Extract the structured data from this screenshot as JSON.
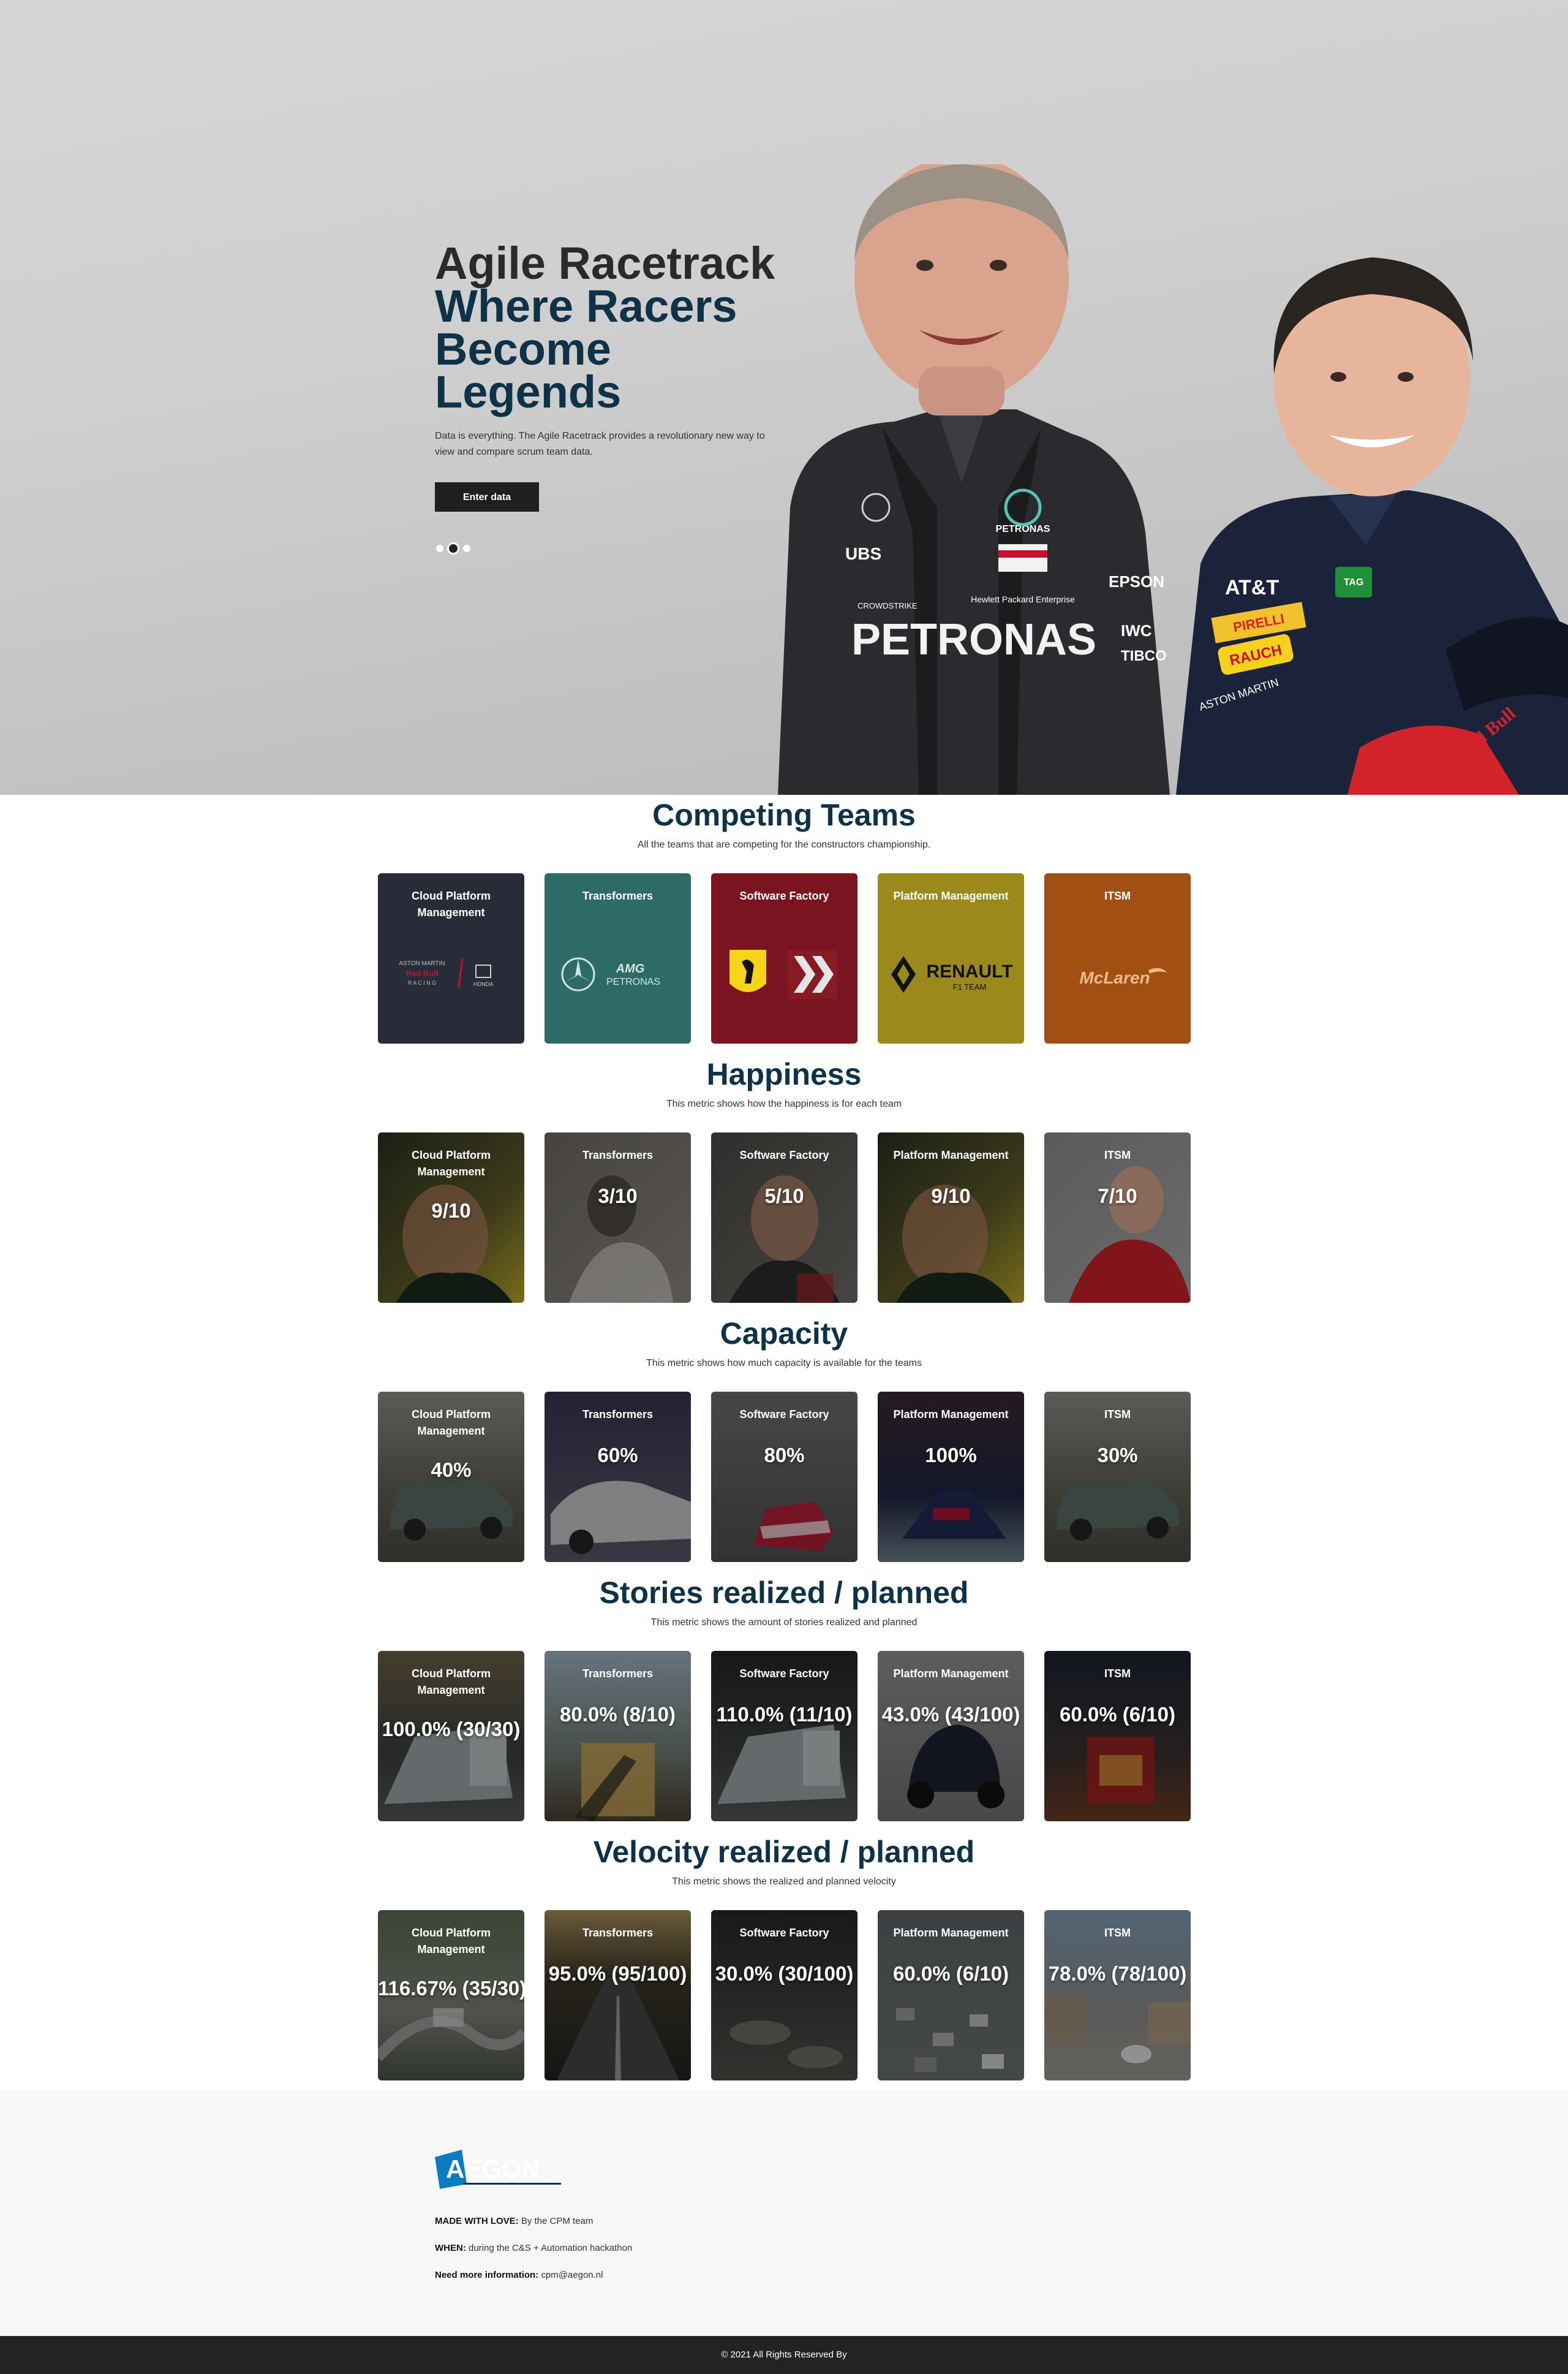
{
  "hero": {
    "title_line1": "Agile Racetrack",
    "title_line2": "Where Racers",
    "title_line3": "Become",
    "title_line4": "Legends",
    "description": "Data is everything. The Agile Racetrack provides a revolutionary new way to view and compare scrum team data.",
    "button_label": "Enter data",
    "racer1_suit": "PETRONAS",
    "racer1_brands": [
      "PETRONAS",
      "UBS",
      "Hewlett Packard Enterprise",
      "EPSON",
      "IWC",
      "TIBCO",
      "CROWDSTRIKE"
    ],
    "racer2_brands": [
      "AT&T",
      "TAG",
      "PIRELLI",
      "RAUCH",
      "ASTON MARTIN",
      "Red Bull"
    ],
    "carousel": {
      "count": 3,
      "active": 1
    }
  },
  "sections": [
    {
      "title": "Competing Teams",
      "subtitle": "All the teams that are competing for the constructors championship.",
      "cards": [
        {
          "name": "Cloud Platform Management",
          "value": "",
          "logo": "ASTON MARTIN | Red Bull RACING | HONDA",
          "bg": "#272c38"
        },
        {
          "name": "Transformers",
          "value": "",
          "logo": "AMG PETRONAS",
          "bg": "#2f6b66"
        },
        {
          "name": "Software Factory",
          "value": "",
          "logo": "Ferrari",
          "bg": "#7a1420"
        },
        {
          "name": "Platform Management",
          "value": "",
          "logo": "RENAULT F1 TEAM",
          "bg": "#9b8a1b"
        },
        {
          "name": "ITSM",
          "value": "",
          "logo": "McLaren",
          "bg": "#a24f14"
        }
      ]
    },
    {
      "title": "Happiness",
      "subtitle": "This metric shows how the happiness is for each team",
      "cards": [
        {
          "name": "Cloud Platform Management",
          "value": "9/10",
          "bg": "#4a4d2b"
        },
        {
          "name": "Transformers",
          "value": "3/10",
          "bg": "#6a6662"
        },
        {
          "name": "Software Factory",
          "value": "5/10",
          "bg": "#5c5a57"
        },
        {
          "name": "Platform Management",
          "value": "9/10",
          "bg": "#4a4d2b"
        },
        {
          "name": "ITSM",
          "value": "7/10",
          "bg": "#8a3a3a"
        }
      ]
    },
    {
      "title": "Capacity",
      "subtitle": "This metric shows how much capacity is available for the teams",
      "cards": [
        {
          "name": "Cloud Platform Management",
          "value": "40%",
          "bg": "#5b5a50"
        },
        {
          "name": "Transformers",
          "value": "60%",
          "bg": "#4a4656"
        },
        {
          "name": "Software Factory",
          "value": "80%",
          "bg": "#5d5d5d"
        },
        {
          "name": "Platform Management",
          "value": "100%",
          "bg": "#2b2f4a"
        },
        {
          "name": "ITSM",
          "value": "30%",
          "bg": "#5b5a50"
        }
      ]
    },
    {
      "title": "Stories realized / planned",
      "subtitle": "This metric shows the amount of stories realized and planned",
      "cards": [
        {
          "name": "Cloud Platform Management",
          "value": "100.0% (30/30)",
          "bg": "#3d4240"
        },
        {
          "name": "Transformers",
          "value": "80.0% (8/10)",
          "bg": "#5a5040"
        },
        {
          "name": "Software Factory",
          "value": "110.0% (11/10)",
          "bg": "#2f3330"
        },
        {
          "name": "Platform Management",
          "value": "43.0% (43/100)",
          "bg": "#5a5a5a"
        },
        {
          "name": "ITSM",
          "value": "60.0% (6/10)",
          "bg": "#2a2a33"
        }
      ]
    },
    {
      "title": "Velocity realized / planned",
      "subtitle": "This metric shows the realized and planned velocity",
      "cards": [
        {
          "name": "Cloud Platform Management",
          "value": "116.67% (35/30)",
          "bg": "#4a5248"
        },
        {
          "name": "Transformers",
          "value": "95.0% (95/100)",
          "bg": "#3b3628"
        },
        {
          "name": "Software Factory",
          "value": "30.0% (30/100)",
          "bg": "#3e3e3c"
        },
        {
          "name": "Platform Management",
          "value": "60.0% (6/10)",
          "bg": "#555a5c"
        },
        {
          "name": "ITSM",
          "value": "78.0% (78/100)",
          "bg": "#5f6670"
        }
      ]
    }
  ],
  "footer": {
    "brand": "AEGON",
    "made_label": "MADE WITH LOVE:",
    "made_value": "By the CPM team",
    "when_label": "WHEN:",
    "when_value": "during the C&S + Automation hackathon",
    "info_label": "Need more information:",
    "info_value": "cpm@aegon.nl",
    "copyright": "© 2021 All Rights Reserved By"
  }
}
